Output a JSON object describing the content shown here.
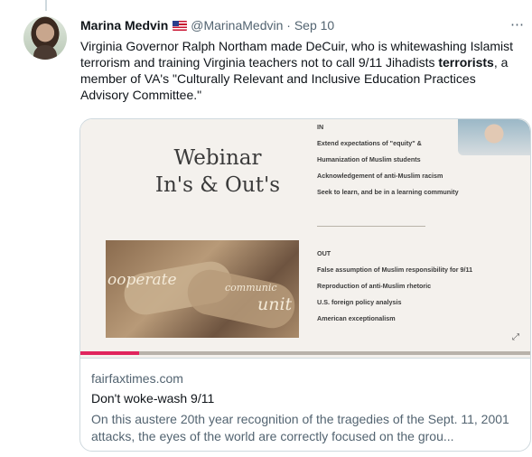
{
  "tweet": {
    "name": "Marina Medvin",
    "handle": "@MarinaMedvin",
    "separator": "·",
    "date": "Sep 10",
    "text_part1": "Virginia Governor Ralph Northam made DeCuir, who is whitewashing Islamist terrorism and training Virginia teachers not to call 9/11 Jihadists ",
    "text_bold": "terrorists",
    "text_part2": ", a member of VA's \"Culturally Relevant and Inclusive Education Practices Advisory Committee.\"",
    "more_icon": "more-dots-icon"
  },
  "media": {
    "title_line1": "Webinar",
    "title_line2": "In's & Out's",
    "in_heading": "IN",
    "in_items": [
      "Extend expectations of \"equity\" &",
      "Humanization of Muslim students",
      "Acknowledgement of anti-Muslim racism",
      "Seek to learn, and be in a learning community"
    ],
    "out_heading": "OUT",
    "out_items": [
      "False assumption of Muslim responsibility for 9/11",
      "Reproduction of anti-Muslim rhetoric",
      "U.S. foreign policy analysis",
      "American exceptionalism"
    ],
    "handshake_words": [
      "ooperate",
      "communic",
      "unit"
    ],
    "progress": 0.13
  },
  "card": {
    "domain": "fairfaxtimes.com",
    "title": "Don't woke-wash 9/11",
    "description": "On this austere 20th year recognition of the tragedies of the Sept. 11, 2001 attacks, the eyes of the world are correctly focused on the grou..."
  }
}
